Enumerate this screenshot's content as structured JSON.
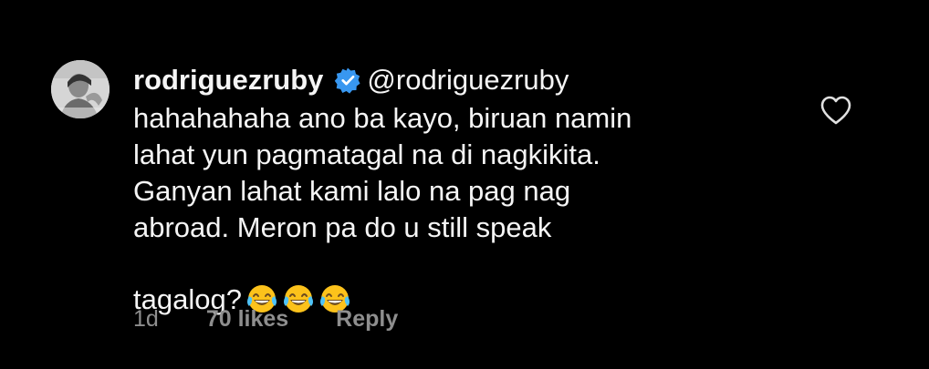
{
  "comment": {
    "username": "rodriguezruby",
    "verified_icon": "verified-badge-icon",
    "handle": "@rodriguezruby",
    "text_lines": [
      "hahahahaha ano ba kayo, biruan namin",
      "lahat yun pagmatagal na di nagkikita.",
      "Ganyan lahat kami lalo na pag nag",
      "abroad. Meron pa do u still speak",
      "tagalog?"
    ],
    "emojis": [
      "😂",
      "😂",
      "😂"
    ],
    "time": "1d",
    "likes": "70 likes",
    "reply_label": "Reply",
    "like_icon": "heart-outline-icon",
    "avatar_icon": "profile-photo"
  },
  "colors": {
    "background": "#000000",
    "text_primary": "#f5f5f5",
    "text_secondary": "#8e8e8e",
    "verified_blue": "#3897f0"
  }
}
